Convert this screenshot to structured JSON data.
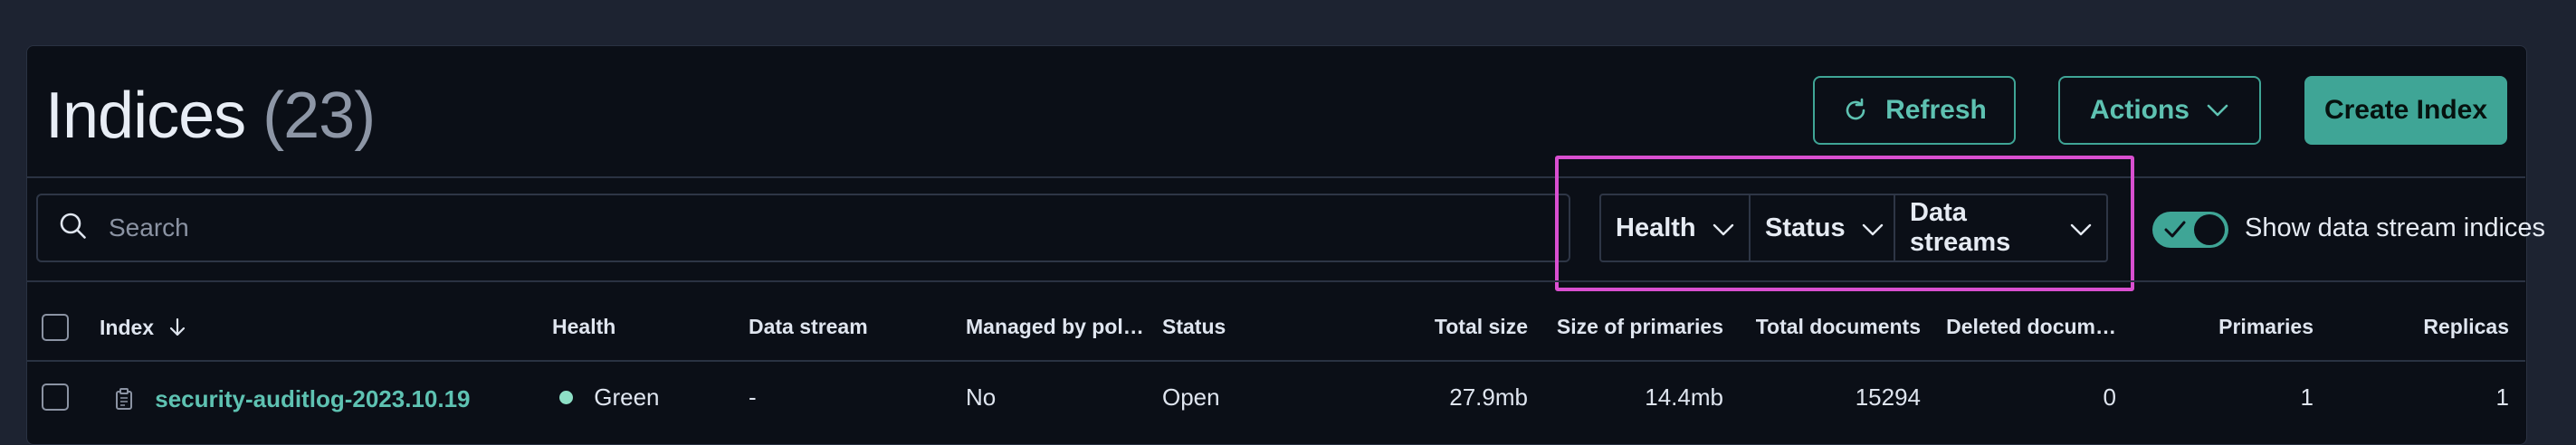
{
  "page": {
    "title": "Indices",
    "count": "(23)"
  },
  "toolbar": {
    "refresh_label": "Refresh",
    "actions_label": "Actions",
    "create_label": "Create Index"
  },
  "search": {
    "placeholder": "Search"
  },
  "filters": [
    {
      "label": "Health"
    },
    {
      "label": "Status"
    },
    {
      "label": "Data streams"
    }
  ],
  "toggle": {
    "label": "Show data stream indices",
    "on": true
  },
  "table": {
    "columns": {
      "index": "Index",
      "health": "Health",
      "data_stream": "Data stream",
      "managed": "Managed by pol…",
      "status": "Status",
      "total_size": "Total size",
      "primary_size": "Size of primaries",
      "total_docs": "Total documents",
      "deleted_docs": "Deleted docum…",
      "primaries": "Primaries",
      "replicas": "Replicas"
    },
    "rows": [
      {
        "index": "security-auditlog-2023.10.19",
        "health": "Green",
        "data_stream": "-",
        "managed": "No",
        "status": "Open",
        "total_size": "27.9mb",
        "primary_size": "14.4mb",
        "total_docs": "15294",
        "deleted_docs": "0",
        "primaries": "1",
        "replicas": "1"
      }
    ]
  },
  "colors": {
    "accent": "#3fa596",
    "highlight": "#d94fd0",
    "health_green": "#8de0c6"
  },
  "icons": {
    "refresh": "refresh-icon",
    "chevron": "chevron-down-icon",
    "search": "search-icon",
    "sort": "arrow-down-icon",
    "document": "document-icon",
    "check": "check-icon"
  }
}
